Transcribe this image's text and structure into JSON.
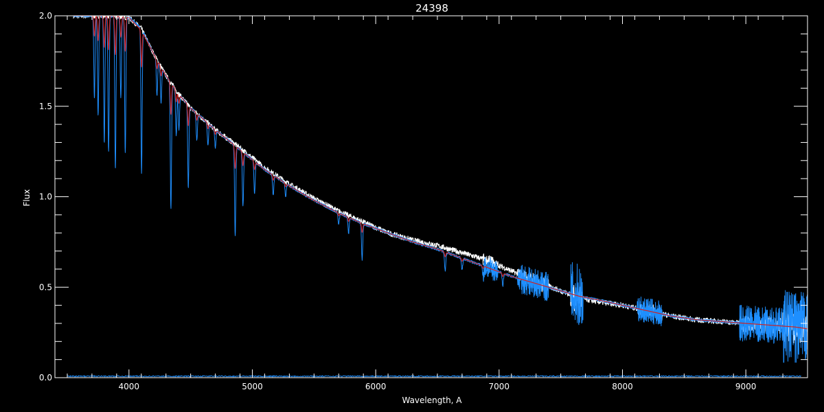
{
  "chart_data": {
    "type": "line",
    "title": "24398",
    "xlabel": "Wavelength, A",
    "ylabel": "Flux",
    "xlim": [
      3400,
      9500
    ],
    "ylim": [
      0.0,
      2.0
    ],
    "x_ticks": [
      4000,
      5000,
      6000,
      7000,
      8000,
      9000
    ],
    "y_ticks": [
      0.0,
      0.5,
      1.0,
      1.5,
      2.0
    ],
    "x_tick_labels": [
      "4000",
      "5000",
      "6000",
      "7000",
      "8000",
      "9000"
    ],
    "y_tick_labels": [
      "0.0",
      "0.5",
      "1.0",
      "1.5",
      "2.0"
    ],
    "grid": false,
    "legend": "none",
    "colors": {
      "background": "#000000",
      "axes": "#ffffff",
      "observed": "#ffffff",
      "model": "#1e8fff",
      "fit": "#cc2222"
    },
    "series": [
      {
        "color": "#ffffff",
        "x": [
          3550,
          3700,
          3850,
          4000,
          4100,
          4200,
          4300,
          4400,
          4500,
          4700,
          4900,
          5100,
          5300,
          5500,
          5700,
          5900,
          6100,
          6300,
          6500,
          6700,
          6900,
          7100,
          7300,
          7500,
          7650,
          7800,
          8000,
          8200,
          8400,
          8600,
          8800,
          9000,
          9200,
          9400,
          9500
        ],
        "y": [
          2.0,
          2.0,
          2.0,
          1.99,
          1.93,
          1.79,
          1.67,
          1.57,
          1.49,
          1.37,
          1.27,
          1.16,
          1.07,
          0.99,
          0.92,
          0.86,
          0.8,
          0.76,
          0.73,
          0.69,
          0.65,
          0.59,
          0.53,
          0.48,
          0.44,
          0.42,
          0.4,
          0.37,
          0.34,
          0.32,
          0.31,
          0.3,
          0.29,
          0.28,
          0.27
        ]
      },
      {
        "color": "#1e8fff",
        "x": [
          3550,
          3700,
          3850,
          4000,
          4100,
          4200,
          4300,
          4400,
          4500,
          4700,
          4900,
          5100,
          5300,
          5500,
          5700,
          5900,
          6100,
          6300,
          6500,
          6700,
          6900,
          7100,
          7300,
          7500,
          7650,
          7800,
          8000,
          8200,
          8400,
          8600,
          8800,
          9000,
          9200,
          9400,
          9500
        ],
        "y": [
          2.0,
          2.0,
          2.0,
          1.99,
          1.93,
          1.79,
          1.67,
          1.57,
          1.49,
          1.37,
          1.26,
          1.15,
          1.06,
          0.98,
          0.91,
          0.85,
          0.8,
          0.75,
          0.71,
          0.66,
          0.61,
          0.56,
          0.52,
          0.48,
          0.45,
          0.43,
          0.4,
          0.37,
          0.34,
          0.32,
          0.31,
          0.3,
          0.29,
          0.28,
          0.27
        ]
      },
      {
        "color": "#cc2222",
        "x": [
          3550,
          3700,
          3850,
          4000,
          4100,
          4200,
          4300,
          4400,
          4500,
          4700,
          4900,
          5100,
          5300,
          5500,
          5700,
          5900,
          6100,
          6300,
          6500,
          6700,
          6900,
          7100,
          7300,
          7500,
          7650,
          7800,
          8000,
          8200,
          8400,
          8600,
          8800,
          9000,
          9200,
          9400,
          9500
        ],
        "y": [
          2.0,
          2.0,
          2.0,
          1.99,
          1.92,
          1.79,
          1.67,
          1.57,
          1.49,
          1.37,
          1.26,
          1.15,
          1.06,
          0.98,
          0.91,
          0.85,
          0.8,
          0.75,
          0.71,
          0.66,
          0.61,
          0.56,
          0.52,
          0.48,
          0.45,
          0.43,
          0.4,
          0.37,
          0.34,
          0.32,
          0.31,
          0.3,
          0.29,
          0.28,
          0.27
        ]
      }
    ],
    "absorption_lines": [
      {
        "x": 3720,
        "depth": 0.45
      },
      {
        "x": 3750,
        "depth": 0.55
      },
      {
        "x": 3800,
        "depth": 0.7
      },
      {
        "x": 3835,
        "depth": 0.75
      },
      {
        "x": 3890,
        "depth": 0.85
      },
      {
        "x": 3934,
        "depth": 0.45
      },
      {
        "x": 3970,
        "depth": 0.75
      },
      {
        "x": 4102,
        "depth": 0.8
      },
      {
        "x": 4227,
        "depth": 0.2
      },
      {
        "x": 4260,
        "depth": 0.2
      },
      {
        "x": 4340,
        "depth": 0.7
      },
      {
        "x": 4383,
        "depth": 0.25
      },
      {
        "x": 4405,
        "depth": 0.2
      },
      {
        "x": 4481,
        "depth": 0.45
      },
      {
        "x": 4550,
        "depth": 0.15
      },
      {
        "x": 4640,
        "depth": 0.12
      },
      {
        "x": 4700,
        "depth": 0.1
      },
      {
        "x": 4861,
        "depth": 0.5
      },
      {
        "x": 4924,
        "depth": 0.3
      },
      {
        "x": 5018,
        "depth": 0.18
      },
      {
        "x": 5169,
        "depth": 0.12
      },
      {
        "x": 5270,
        "depth": 0.08
      },
      {
        "x": 5700,
        "depth": 0.08
      },
      {
        "x": 5780,
        "depth": 0.12
      },
      {
        "x": 5890,
        "depth": 0.28
      },
      {
        "x": 6563,
        "depth": 0.18
      },
      {
        "x": 6700,
        "depth": 0.12
      },
      {
        "x": 6870,
        "depth": 0.1
      },
      {
        "x": 7030,
        "depth": 0.15
      }
    ],
    "noise_regions": [
      {
        "x": [
          6870,
          6990
        ],
        "amplitude": 0.06
      },
      {
        "x": [
          7150,
          7400
        ],
        "amplitude": 0.08
      },
      {
        "x": [
          7580,
          7680
        ],
        "amplitude": 0.18
      },
      {
        "x": [
          8120,
          8320
        ],
        "amplitude": 0.07
      },
      {
        "x": [
          8950,
          9400
        ],
        "amplitude": 0.1
      },
      {
        "x": [
          9300,
          9500
        ],
        "amplitude": 0.2
      }
    ]
  }
}
